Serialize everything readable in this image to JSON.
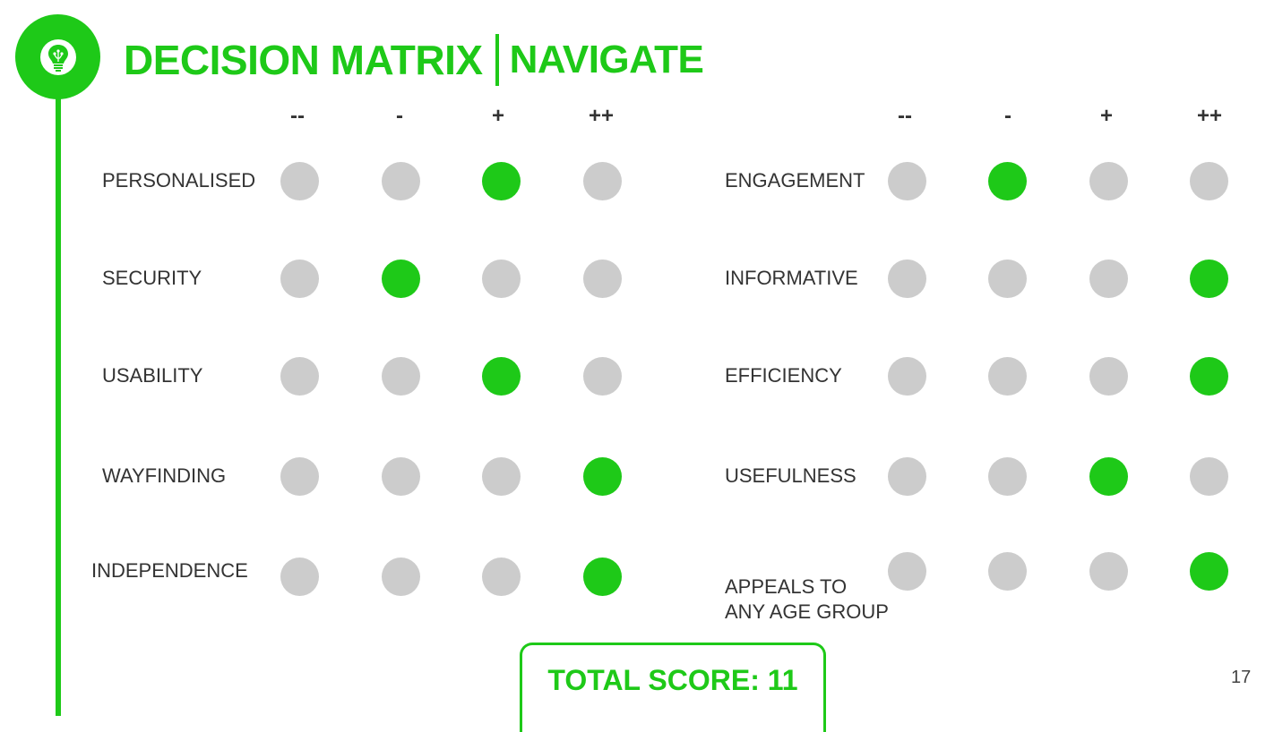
{
  "title": {
    "main": "DECISION MATRIX",
    "sub": "NAVIGATE"
  },
  "scale_headers": [
    "--",
    "-",
    "+",
    "++"
  ],
  "left_criteria": [
    {
      "label": "PERSONALISED",
      "selected": 2
    },
    {
      "label": "SECURITY",
      "selected": 1
    },
    {
      "label": "USABILITY",
      "selected": 2
    },
    {
      "label": "WAYFINDING",
      "selected": 3
    },
    {
      "label": "INDEPENDENCE",
      "selected": 3
    }
  ],
  "right_criteria": [
    {
      "label": "ENGAGEMENT",
      "selected": 1
    },
    {
      "label": "INFORMATIVE",
      "selected": 3
    },
    {
      "label": "EFFICIENCY",
      "selected": 3
    },
    {
      "label": "USEFULNESS",
      "selected": 2
    },
    {
      "label": "APPEALS TO\nANY AGE GROUP",
      "selected": 3
    }
  ],
  "total_score": "TOTAL SCORE: 11",
  "page_number": "17",
  "colors": {
    "accent": "#1ec918",
    "inactive": "#cccccc",
    "text": "#333333"
  },
  "icons": {
    "logo": "lightbulb-icon"
  }
}
